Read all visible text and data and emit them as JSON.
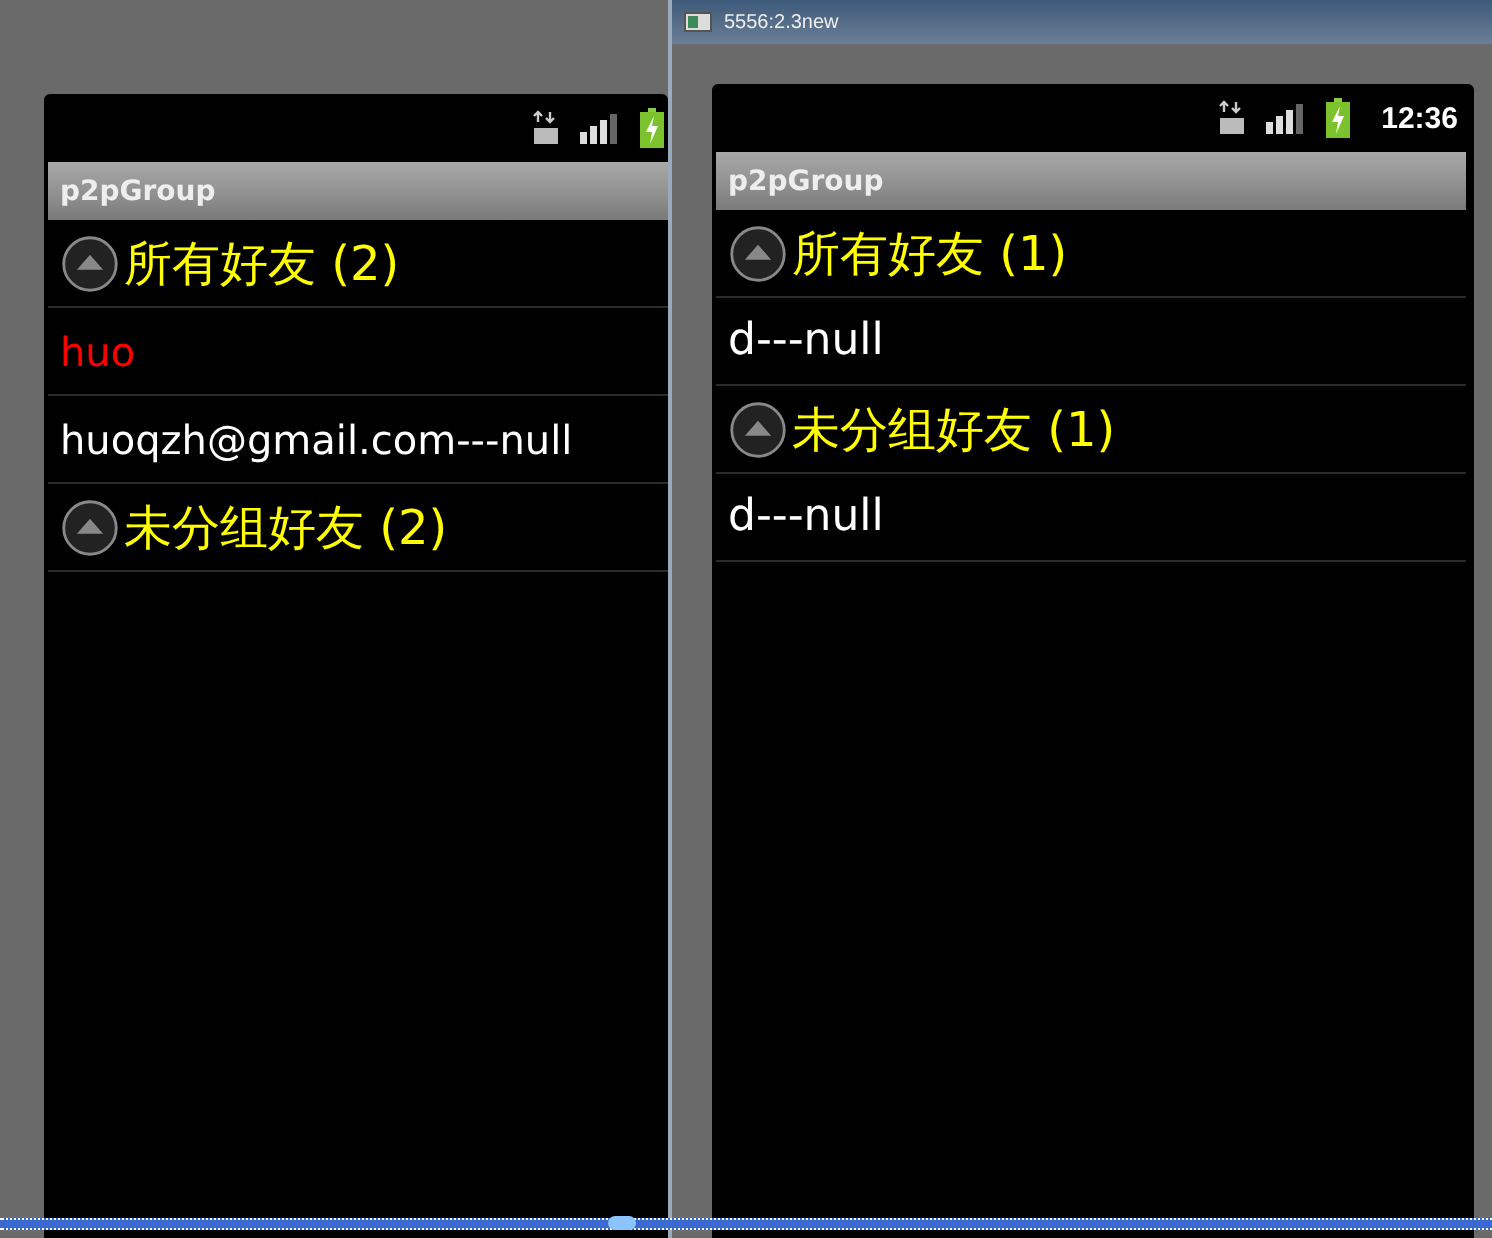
{
  "emulators": [
    {
      "app_title": "p2pGroup",
      "items": [
        {
          "kind": "group",
          "label": "所有好友 (2)",
          "expanded": true
        },
        {
          "kind": "contact",
          "label": "huo",
          "color": "#ff0000"
        },
        {
          "kind": "contact",
          "label": "huoqzh@gmail.com---null",
          "color": "#ffffff"
        },
        {
          "kind": "group",
          "label": "未分组好友 (2)",
          "expanded": true
        }
      ]
    },
    {
      "window_title": "5556:2.3new",
      "status_bar": {
        "time": "12:36"
      },
      "app_title": "p2pGroup",
      "items": [
        {
          "kind": "group",
          "label": "所有好友 (1)",
          "expanded": true
        },
        {
          "kind": "contact",
          "label": "d---null",
          "color": "#ffffff"
        },
        {
          "kind": "group",
          "label": "未分组好友 (1)",
          "expanded": true
        },
        {
          "kind": "contact",
          "label": "d---null",
          "color": "#ffffff"
        }
      ]
    }
  ]
}
